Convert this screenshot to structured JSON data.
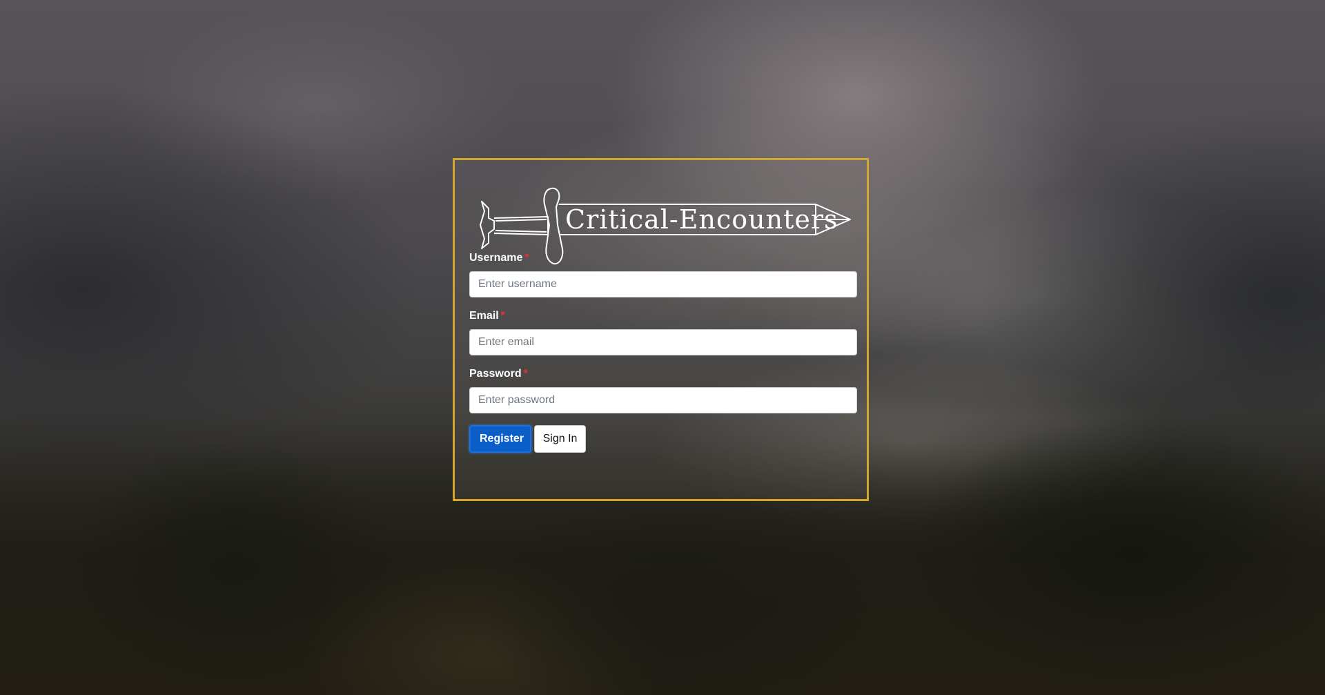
{
  "brand": {
    "logo_text": "Critical-Encounters",
    "accent_color": "#d4a72c"
  },
  "form": {
    "fields": [
      {
        "label": "Username",
        "required_mark": "*",
        "placeholder": "Enter username",
        "value": ""
      },
      {
        "label": "Email",
        "required_mark": "*",
        "placeholder": "Enter email",
        "value": ""
      },
      {
        "label": "Password",
        "required_mark": "*",
        "placeholder": "Enter password",
        "value": ""
      }
    ],
    "register_label": "Register",
    "signin_label": "Sign In",
    "primary_color": "#0b5ec8"
  },
  "icons": {
    "logo": "sword-icon"
  }
}
